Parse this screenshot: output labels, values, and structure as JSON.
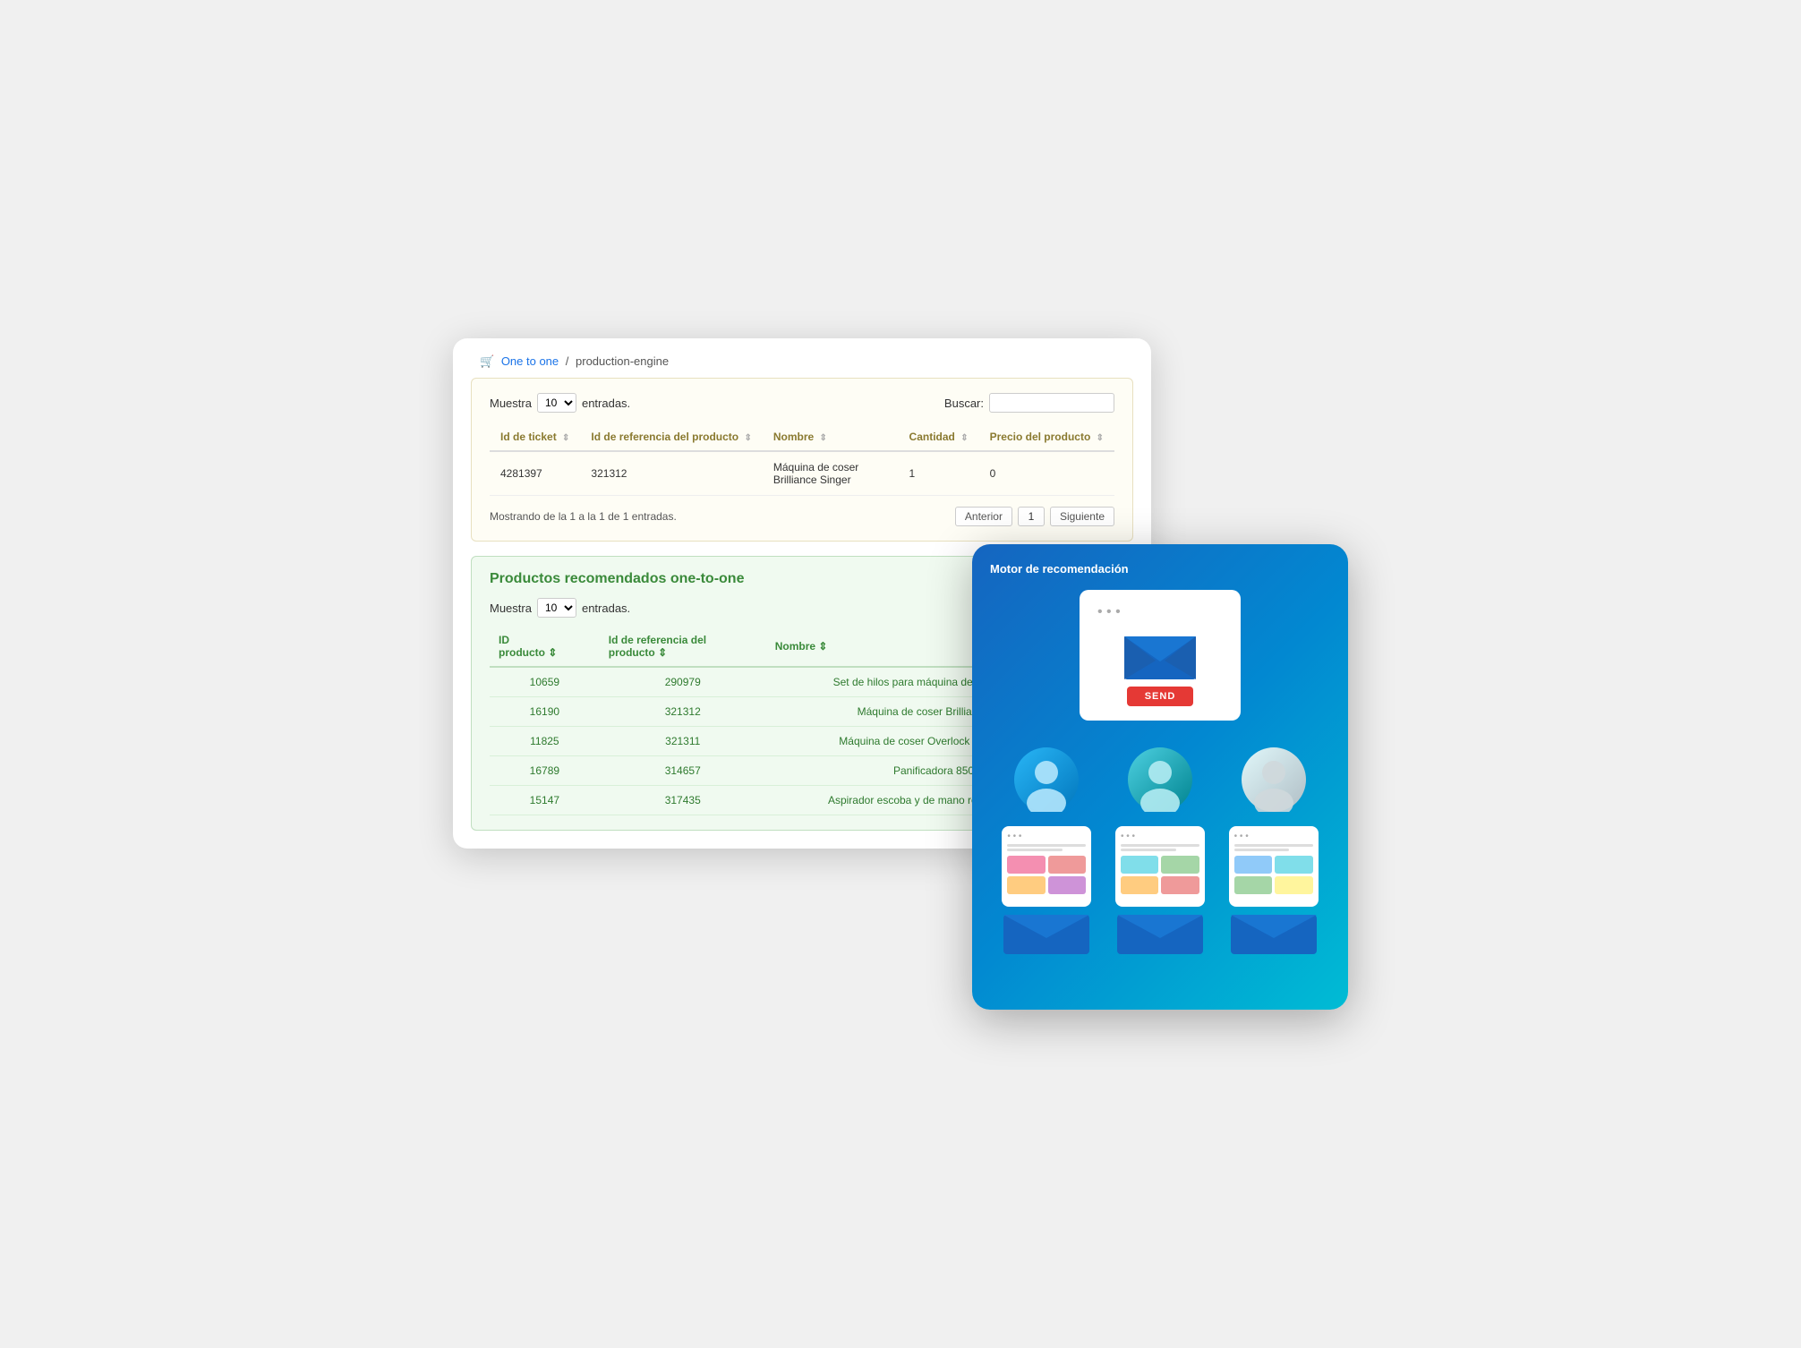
{
  "breadcrumb": {
    "icon": "🛒",
    "link_text": "One to one",
    "separator": "/",
    "current": "production-engine"
  },
  "top_table": {
    "show_label": "Muestra",
    "show_value": "10",
    "entries_label": "entradas.",
    "search_label": "Buscar:",
    "columns": [
      {
        "label": "Id de ticket",
        "key": "id_ticket"
      },
      {
        "label": "Id de referencia del producto",
        "key": "id_ref"
      },
      {
        "label": "Nombre",
        "key": "nombre"
      },
      {
        "label": "Cantidad",
        "key": "cantidad"
      },
      {
        "label": "Precio del producto",
        "key": "precio"
      }
    ],
    "rows": [
      {
        "id_ticket": "4281397",
        "id_ref": "321312",
        "nombre": "Máquina de coser Brilliance Singer",
        "cantidad": "1",
        "precio": "0"
      }
    ],
    "footer_text": "Mostrando de la 1 a la 1 de 1 entradas.",
    "prev_btn": "Anterior",
    "next_btn": "Siguiente",
    "page_num": "1"
  },
  "bottom_table": {
    "title": "Productos recomendados one-to-one",
    "show_label": "Muestra",
    "show_value": "10",
    "entries_label": "entradas.",
    "columns": [
      {
        "label": "ID producto",
        "key": "id_producto"
      },
      {
        "label": "Id de referencia del producto",
        "key": "id_ref"
      },
      {
        "label": "Nombre",
        "key": "nombre"
      }
    ],
    "rows": [
      {
        "id_producto": "10659",
        "id_ref": "290979",
        "nombre": "Set de hilos para máquina de coser Overlock"
      },
      {
        "id_producto": "16190",
        "id_ref": "321312",
        "nombre": "Máquina de coser Brilliance Singer"
      },
      {
        "id_producto": "11825",
        "id_ref": "321311",
        "nombre": "Máquina de coser Overlock Singer S14-78"
      },
      {
        "id_producto": "16789",
        "id_ref": "314657",
        "nombre": "Panificadora 850 W"
      },
      {
        "id_producto": "15147",
        "id_ref": "317435",
        "nombre": "Aspirador escoba y de mano recargable 130 W"
      }
    ]
  },
  "rec_card": {
    "title": "Motor de recomendación",
    "send_button_label": "SEND",
    "avatars": [
      {
        "color": "blue"
      },
      {
        "color": "teal"
      },
      {
        "color": "gray"
      }
    ],
    "mini_cards": [
      {
        "cells": [
          {
            "color": "#f48fb1"
          },
          {
            "color": "#ef9a9a"
          },
          {
            "color": "#ffcc80"
          },
          {
            "color": "#ce93d8"
          }
        ]
      },
      {
        "cells": [
          {
            "color": "#80deea"
          },
          {
            "color": "#a5d6a7"
          },
          {
            "color": "#ffcc80"
          },
          {
            "color": "#ef9a9a"
          }
        ]
      },
      {
        "cells": [
          {
            "color": "#90caf9"
          },
          {
            "color": "#80deea"
          },
          {
            "color": "#a5d6a7"
          },
          {
            "color": "#fff59d"
          }
        ]
      }
    ]
  }
}
